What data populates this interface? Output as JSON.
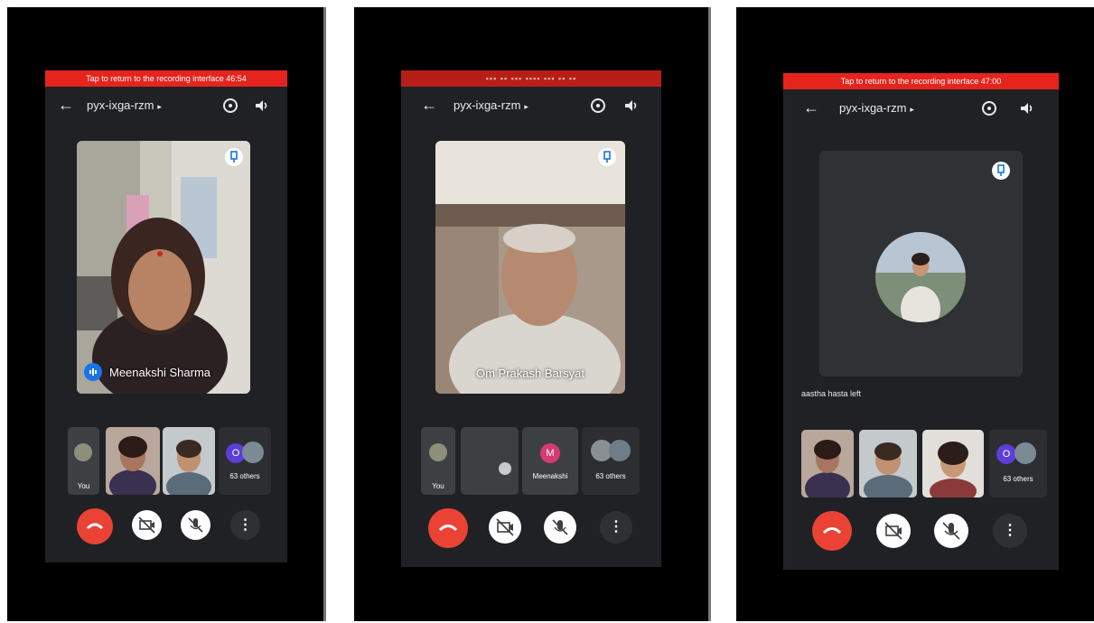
{
  "panels": [
    {
      "recording_banner": "Tap to return to the recording interface  46:54",
      "meeting_code": "pyx-ixga-rzm",
      "main_speaker": "Meenakshi Sharma",
      "thumbnails": [
        {
          "label": "You"
        },
        {
          "label": ""
        },
        {
          "label": ""
        },
        {
          "label": "63 others",
          "avatar_letter": "O"
        }
      ]
    },
    {
      "meeting_code": "pyx-ixga-rzm",
      "main_speaker": "Om Prakash Barsyat",
      "thumbnails": [
        {
          "label": "You"
        },
        {
          "label": ""
        },
        {
          "label": "Meenakshi",
          "avatar_letter": "M"
        },
        {
          "label": "63 others"
        }
      ]
    },
    {
      "recording_banner": "Tap to return to the recording interface  47:00",
      "meeting_code": "pyx-ixga-rzm",
      "status_message": "aastha hasta left",
      "thumbnails": [
        {
          "label": ""
        },
        {
          "label": ""
        },
        {
          "label": ""
        },
        {
          "label": "63 others",
          "avatar_letter": "O"
        }
      ]
    }
  ],
  "colors": {
    "recording_red": "#e5241d",
    "end_call_red": "#ea4335",
    "meet_dark": "#202124",
    "avatar_purple": "#5b3fd6",
    "avatar_pink": "#d63a6f"
  },
  "icons": {
    "back": "arrow-left-icon",
    "switch_camera": "switch-camera-icon",
    "speaker": "speaker-icon",
    "pin": "pin-icon",
    "end_call": "end-call-icon",
    "camera_off": "camera-off-icon",
    "mic_off": "mic-off-icon",
    "more": "more-vert-icon"
  }
}
